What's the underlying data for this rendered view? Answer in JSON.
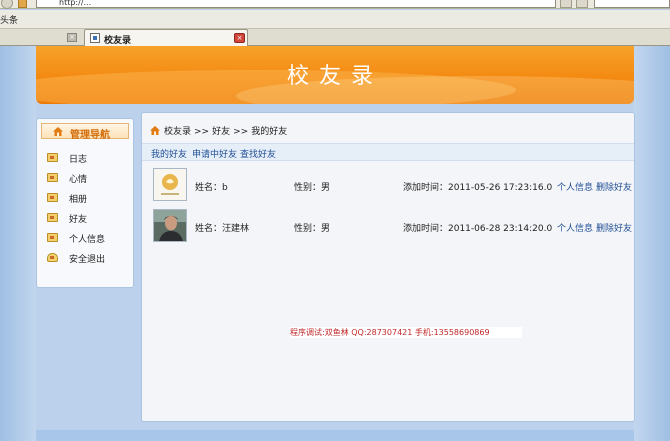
{
  "browser": {
    "url": "http://...",
    "search_placeholder": "",
    "favorites_label": "头条",
    "tab_title": "校友录",
    "tab_close": "×",
    "inactive_close": "×"
  },
  "banner": {
    "title": "校友录"
  },
  "sidebar": {
    "title": "管理导航",
    "items": [
      {
        "label": "日志",
        "icon": "diary-icon"
      },
      {
        "label": "心情",
        "icon": "mood-icon"
      },
      {
        "label": "相册",
        "icon": "album-icon"
      },
      {
        "label": "好友",
        "icon": "friends-icon"
      },
      {
        "label": "个人信息",
        "icon": "profile-icon"
      },
      {
        "label": "安全退出",
        "icon": "logout-icon"
      }
    ]
  },
  "breadcrumb": {
    "home": "校友录",
    "sep1": ">>",
    "section": "好友",
    "sep2": ">>",
    "current": "我的好友"
  },
  "sub_tabs": [
    "我的好友",
    "申请中好友",
    "查找好友"
  ],
  "friends": [
    {
      "name": "姓名：b",
      "gender": "性别：男",
      "added": "添加时间：2011-05-26 17:23:16.0",
      "link_info": "个人信息",
      "link_delete": "删除好友"
    },
    {
      "name": "姓名：汪建林",
      "gender": "性别：男",
      "added": "添加时间：2011-06-28 23:14:20.0",
      "link_info": "个人信息",
      "link_delete": "删除好友"
    }
  ],
  "credits": "程序调试:双鱼林 QQ:287307421 手机:13558690869"
}
